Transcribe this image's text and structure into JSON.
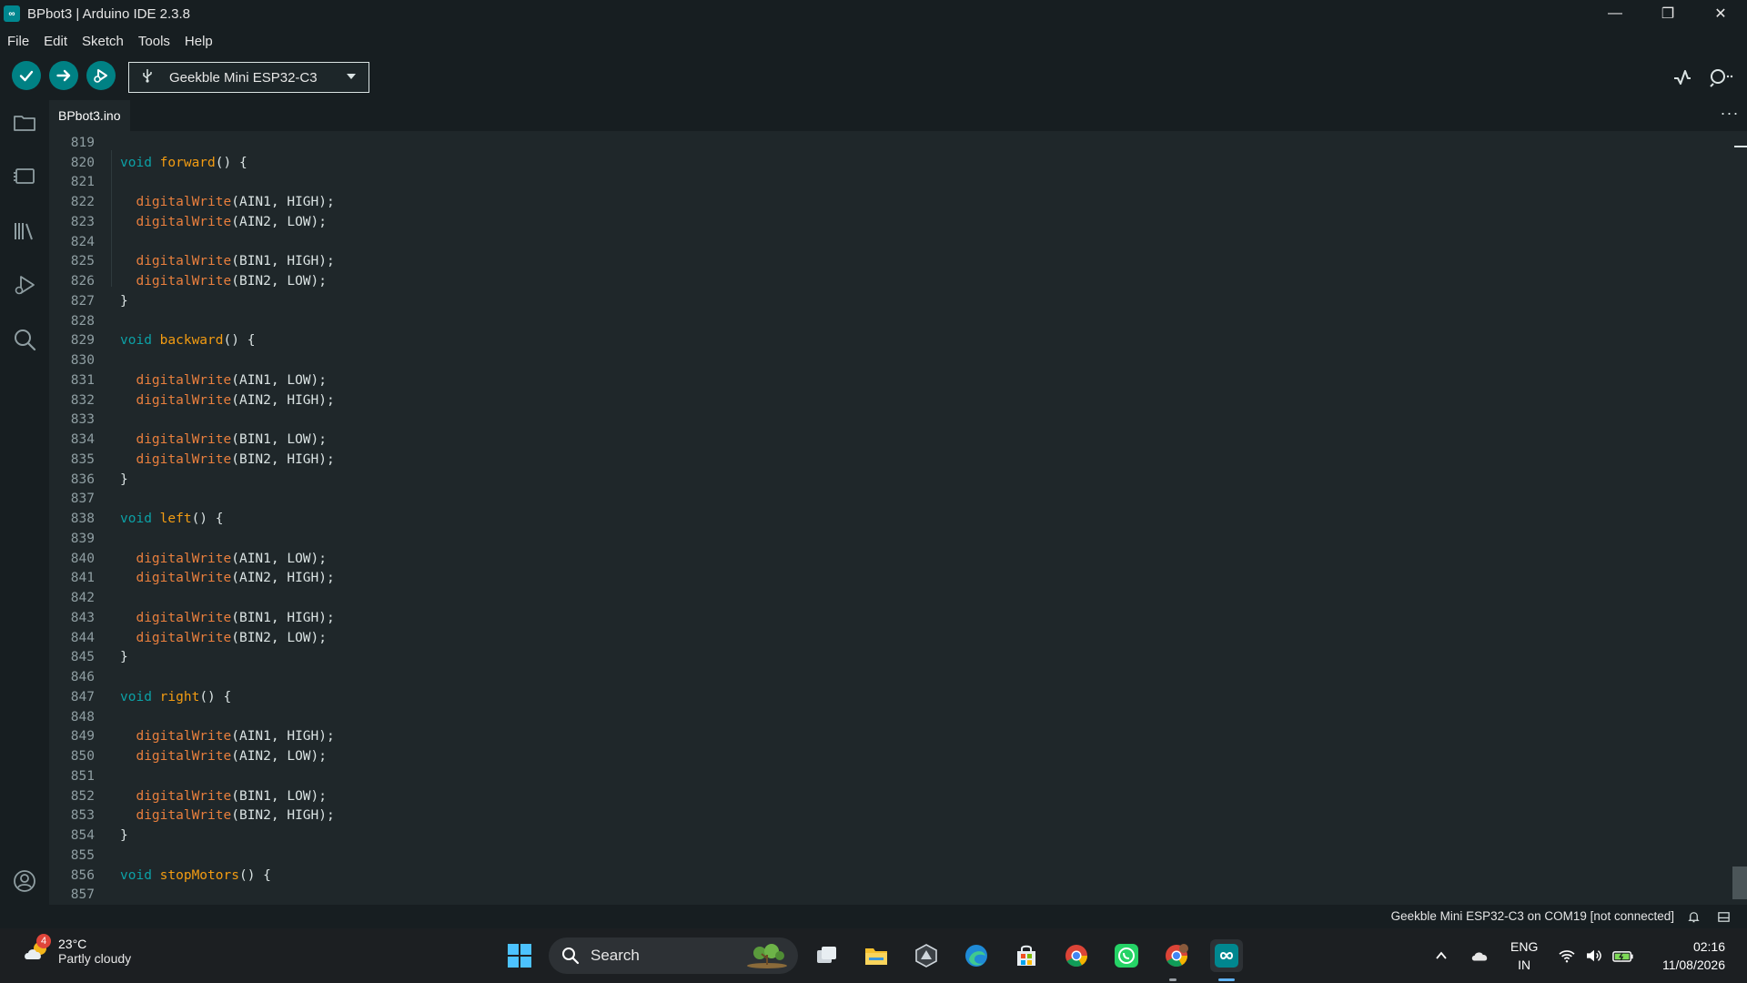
{
  "window": {
    "title": "BPbot3 | Arduino IDE 2.3.8",
    "minimize": "—",
    "maximize": "❐",
    "close": "✕"
  },
  "menu": [
    "File",
    "Edit",
    "Sketch",
    "Tools",
    "Help"
  ],
  "toolbar": {
    "board": "Geekble Mini ESP32-C3"
  },
  "tabs": {
    "active": "BPbot3.ino",
    "more": "···"
  },
  "editor": {
    "lines": [
      {
        "n": "819",
        "code": ""
      },
      {
        "n": "820",
        "code": "void forward() {"
      },
      {
        "n": "821",
        "code": ""
      },
      {
        "n": "822",
        "code": "  digitalWrite(AIN1, HIGH);"
      },
      {
        "n": "823",
        "code": "  digitalWrite(AIN2, LOW);"
      },
      {
        "n": "824",
        "code": ""
      },
      {
        "n": "825",
        "code": "  digitalWrite(BIN1, HIGH);"
      },
      {
        "n": "826",
        "code": "  digitalWrite(BIN2, LOW);"
      },
      {
        "n": "827",
        "code": "}"
      },
      {
        "n": "828",
        "code": ""
      },
      {
        "n": "829",
        "code": "void backward() {"
      },
      {
        "n": "830",
        "code": ""
      },
      {
        "n": "831",
        "code": "  digitalWrite(AIN1, LOW);"
      },
      {
        "n": "832",
        "code": "  digitalWrite(AIN2, HIGH);"
      },
      {
        "n": "833",
        "code": ""
      },
      {
        "n": "834",
        "code": "  digitalWrite(BIN1, LOW);"
      },
      {
        "n": "835",
        "code": "  digitalWrite(BIN2, HIGH);"
      },
      {
        "n": "836",
        "code": "}"
      },
      {
        "n": "837",
        "code": ""
      },
      {
        "n": "838",
        "code": "void left() {"
      },
      {
        "n": "839",
        "code": ""
      },
      {
        "n": "840",
        "code": "  digitalWrite(AIN1, LOW);"
      },
      {
        "n": "841",
        "code": "  digitalWrite(AIN2, HIGH);"
      },
      {
        "n": "842",
        "code": ""
      },
      {
        "n": "843",
        "code": "  digitalWrite(BIN1, HIGH);"
      },
      {
        "n": "844",
        "code": "  digitalWrite(BIN2, LOW);"
      },
      {
        "n": "845",
        "code": "}"
      },
      {
        "n": "846",
        "code": ""
      },
      {
        "n": "847",
        "code": "void right() {"
      },
      {
        "n": "848",
        "code": ""
      },
      {
        "n": "849",
        "code": "  digitalWrite(AIN1, HIGH);"
      },
      {
        "n": "850",
        "code": "  digitalWrite(AIN2, LOW);"
      },
      {
        "n": "851",
        "code": ""
      },
      {
        "n": "852",
        "code": "  digitalWrite(BIN1, LOW);"
      },
      {
        "n": "853",
        "code": "  digitalWrite(BIN2, HIGH);"
      },
      {
        "n": "854",
        "code": "}"
      },
      {
        "n": "855",
        "code": ""
      },
      {
        "n": "856",
        "code": "void stopMotors() {"
      },
      {
        "n": "857",
        "code": ""
      }
    ]
  },
  "status": {
    "connection": "Geekble Mini ESP32-C3 on COM19 [not connected]"
  },
  "taskbar": {
    "weather_temp": "23°C",
    "weather_desc": "Partly cloudy",
    "weather_badge": "4",
    "search_label": "Search",
    "lang_top": "ENG",
    "lang_bottom": "IN",
    "time": "02:16",
    "date": "11/08/2026"
  },
  "colors": {
    "accent": "#008184",
    "keyword": "#0ca1a6",
    "function": "#e97f3d",
    "editor_bg": "#1f272a",
    "chrome_bg": "#171e21"
  }
}
